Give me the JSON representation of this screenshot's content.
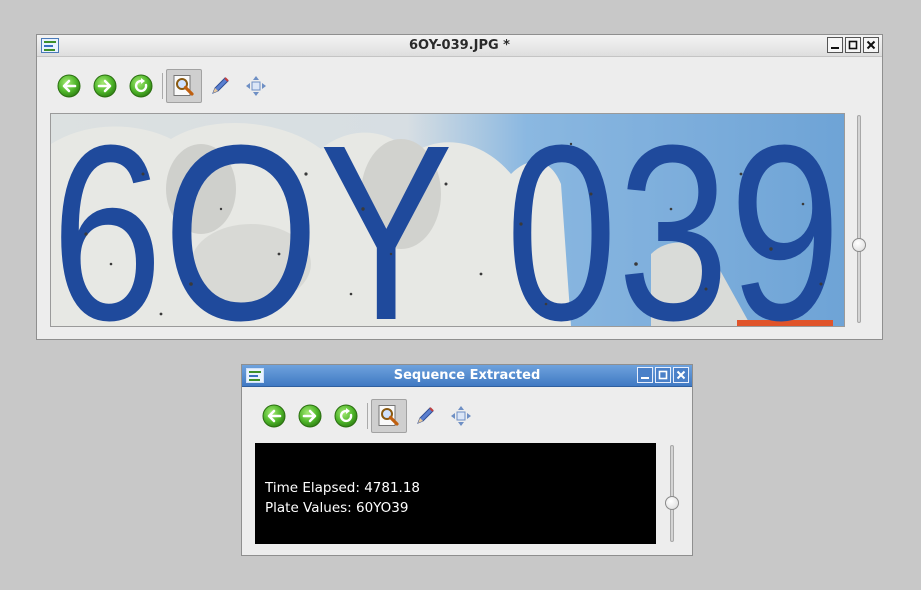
{
  "main_window": {
    "title": "6OY-039.JPG *",
    "image": {
      "plate_text": "6OY 039",
      "colors": {
        "digits": "#1f4a9c",
        "sky": "#2f7fd0",
        "stone": "#e6e7e3"
      }
    }
  },
  "sequence_window": {
    "title": "Sequence Extracted",
    "console": {
      "time_line": "Time Elapsed: 4781.18",
      "plate_line": "Plate Values: 60YO39"
    }
  },
  "toolbar_icons": [
    "back-arrow-icon",
    "forward-arrow-icon",
    "refresh-icon",
    "zoom-inspect-icon",
    "pencil-icon",
    "move-icon"
  ],
  "window_buttons": [
    "minimize-icon",
    "maximize-icon",
    "close-icon"
  ],
  "colors": {
    "desktop": "#c8c8c8",
    "accent_green": "#4fb62a",
    "titlebar_blue": "#4a80c8"
  }
}
